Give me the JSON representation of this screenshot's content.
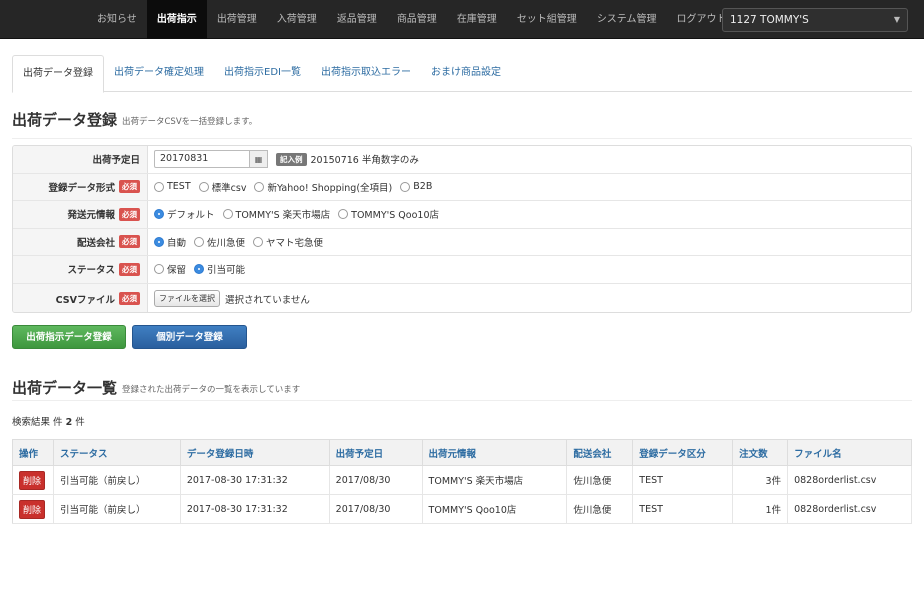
{
  "nav": {
    "items": [
      "お知らせ",
      "出荷指示",
      "出荷管理",
      "入荷管理",
      "返品管理",
      "商品管理",
      "在庫管理",
      "セット組管理",
      "システム管理",
      "ログアウト"
    ],
    "active_index": 1,
    "shop_select": "1127 TOMMY'S"
  },
  "tabs": [
    "出荷データ登録",
    "出荷データ確定処理",
    "出荷指示EDI一覧",
    "出荷指示取込エラー",
    "おまけ商品設定"
  ],
  "upload_section": {
    "title": "出荷データ登録",
    "subtitle": "出荷データCSVを一括登録します。"
  },
  "form": {
    "required_badge": "必須",
    "ship_date": {
      "label": "出荷予定日",
      "value": "20170831",
      "example_badge": "記入例",
      "example_text": "20150716 半角数字のみ"
    },
    "format": {
      "label": "登録データ形式",
      "options": [
        "TEST",
        "標準csv",
        "新Yahoo! Shopping(全項目)",
        "B2B"
      ],
      "selected": -1
    },
    "origin": {
      "label": "発送元情報",
      "options": [
        "デフォルト",
        "TOMMY'S 楽天市場店",
        "TOMMY'S Qoo10店"
      ],
      "selected": 0
    },
    "carrier": {
      "label": "配送会社",
      "options": [
        "自動",
        "佐川急便",
        "ヤマト宅急便"
      ],
      "selected": 0
    },
    "status": {
      "label": "ステータス",
      "options": [
        "保留",
        "引当可能"
      ],
      "selected": 1
    },
    "csv": {
      "label": "CSVファイル",
      "button": "ファイルを選択",
      "status": "選択されていません"
    }
  },
  "buttons": {
    "bulk": "出荷指示データ登録",
    "single": "個別データ登録"
  },
  "list_section": {
    "title": "出荷データ一覧",
    "subtitle": "登録された出荷データの一覧を表示しています"
  },
  "result_count": {
    "label": "検索結果 件",
    "value": "2",
    "unit": "件"
  },
  "table": {
    "headers": [
      "操作",
      "ステータス",
      "データ登録日時",
      "出荷予定日",
      "出荷元情報",
      "配送会社",
      "登録データ区分",
      "注文数",
      "ファイル名"
    ],
    "rows": [
      {
        "action": "削除",
        "status": "引当可能（前戻し）",
        "registered": "2017-08-30 17:31:32",
        "ship_date": "2017/08/30",
        "origin": "TOMMY'S 楽天市場店",
        "carrier": "佐川急便",
        "data_type": "TEST",
        "orders": "3件",
        "file": "0828orderlist.csv"
      },
      {
        "action": "削除",
        "status": "引当可能（前戻し）",
        "registered": "2017-08-30 17:31:32",
        "ship_date": "2017/08/30",
        "origin": "TOMMY'S Qoo10店",
        "carrier": "佐川急便",
        "data_type": "TEST",
        "orders": "1件",
        "file": "0828orderlist.csv"
      }
    ]
  }
}
